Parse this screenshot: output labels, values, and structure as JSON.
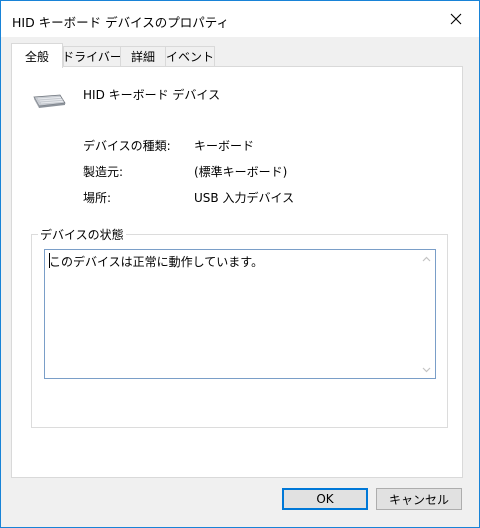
{
  "window": {
    "title": "HID キーボード デバイスのプロパティ"
  },
  "tabs": [
    {
      "label": "全般"
    },
    {
      "label": "ドライバー"
    },
    {
      "label": "詳細"
    },
    {
      "label": "イベント"
    }
  ],
  "device": {
    "name": "HID キーボード デバイス",
    "icon": "keyboard-icon"
  },
  "properties": [
    {
      "label": "デバイスの種類:",
      "value": "キーボード"
    },
    {
      "label": "製造元:",
      "value": "(標準キーボード)"
    },
    {
      "label": "場所:",
      "value": "USB 入力デバイス"
    }
  ],
  "status": {
    "group_title": "デバイスの状態",
    "text": "このデバイスは正常に動作しています。"
  },
  "buttons": {
    "ok": "OK",
    "cancel": "キャンセル"
  },
  "colors": {
    "accent": "#0078d7",
    "border": "#1883d7"
  }
}
